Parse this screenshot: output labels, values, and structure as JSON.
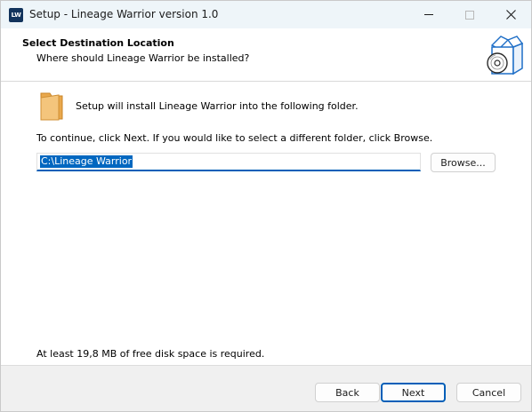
{
  "window": {
    "title": "Setup - Lineage Warrior version 1.0",
    "app_icon_text": "LW"
  },
  "header": {
    "title": "Select Destination Location",
    "subtitle": "Where should Lineage Warrior be installed?"
  },
  "main": {
    "install_text": "Setup will install Lineage Warrior into the following folder.",
    "continue_text": "To continue, click Next. If you would like to select a different folder, click Browse.",
    "path_value": "C:\\Lineage Warrior",
    "browse_label": "Browse...",
    "disk_space_text": "At least 19,8 MB of free disk space is required."
  },
  "footer": {
    "back_label": "Back",
    "next_label": "Next",
    "cancel_label": "Cancel"
  },
  "icons": {
    "app": "lw-app-icon",
    "wizard": "box-disc-icon",
    "folder": "folder-icon",
    "minimize": "minimize-icon",
    "maximize": "maximize-icon",
    "close": "close-icon"
  },
  "colors": {
    "accent": "#005fb8",
    "selection": "#0067c0",
    "title_bar": "#eef5f9",
    "footer_bg": "#f0f0f0"
  }
}
